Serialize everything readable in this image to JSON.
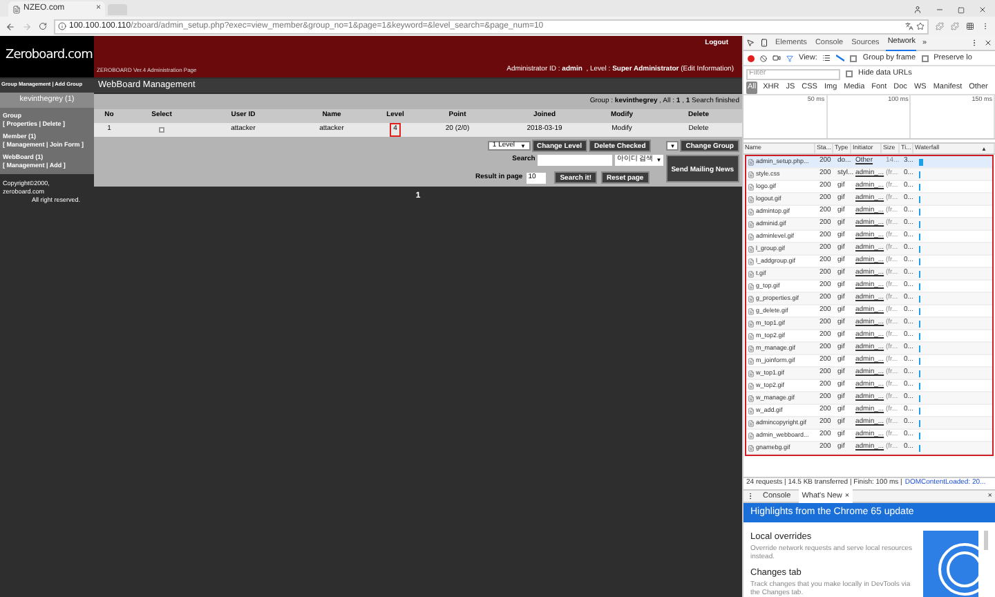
{
  "browser": {
    "tab_title": "NZEO.com",
    "tab_close": "×",
    "url_host": "100.100.100.110",
    "url_path": "/zboard/admin_setup.php?exec=view_member&group_no=1&page=1&keyword=&level_search=&page_num=10"
  },
  "header": {
    "logo": "Zeroboard.com",
    "subtitle": "ZEROBOARD Ver.4 Administration Page",
    "logout": "Logout",
    "admin_label": "Administrator ID :",
    "admin_id": "admin",
    "level_label": ", Level :",
    "level": "Super Administrator",
    "edit": "(Edit Information)"
  },
  "sidebar": {
    "top_links": "Group Management | Add Group",
    "group_name": "kevinthegrey (1)",
    "sections": [
      {
        "title": "Group",
        "links": "[ Properties | Delete ]"
      },
      {
        "title": "Member (1)",
        "links": "[ Management | Join Form ]"
      },
      {
        "title": "WebBoard (1)",
        "links": "[ Management | Add ]"
      }
    ],
    "copyright": "Copyright©2000, zeroboard.com",
    "rights": "All right reserved."
  },
  "main": {
    "title": "WebBoard Management",
    "info": "Group : **kevinthegrey** , All : **1** , **1** Search finished",
    "table": {
      "columns": [
        "No",
        "Select",
        "User ID",
        "Name",
        "Level",
        "Point",
        "Joined",
        "Modify",
        "Delete"
      ],
      "rows": [
        {
          "no": "1",
          "checked": false,
          "user_id": "attacker",
          "name": "attacker",
          "level": "4",
          "level_highlighted": true,
          "point": "20 (2/0)",
          "joined": "2018-03-19",
          "modify": "Modify",
          "delete": "Delete"
        }
      ]
    },
    "level_select": "1 Level",
    "change_level": "Change Level",
    "delete_checked": "Delete Checked",
    "group_select_arrow": "▼",
    "change_group": "Change Group",
    "search_label": "Search",
    "search_select": "아이디 검색",
    "send_mailing": "Send Mailing News",
    "result_label": "Result in page",
    "result_value": "10",
    "search_button": "Search it!",
    "reset_button": "Reset page",
    "pages": [
      {
        "label": "1",
        "selected": true
      }
    ]
  },
  "devtools": {
    "tabs": [
      {
        "label": "Elements",
        "selected": false
      },
      {
        "label": "Console",
        "selected": false
      },
      {
        "label": "Sources",
        "selected": false
      },
      {
        "label": "Network",
        "selected": true
      }
    ],
    "more": "»",
    "view_label": "View:",
    "group_by_frame": {
      "label": "Group by frame",
      "checked": false
    },
    "preserve_log": {
      "label": "Preserve lo",
      "checked": false
    },
    "filter_placeholder": "Filter",
    "hide_data_urls": {
      "label": "Hide data URLs",
      "checked": false
    },
    "types": [
      {
        "label": "All",
        "selected": true
      },
      {
        "label": "XHR",
        "selected": false
      },
      {
        "label": "JS",
        "selected": false
      },
      {
        "label": "CSS",
        "selected": false
      },
      {
        "label": "Img",
        "selected": false
      },
      {
        "label": "Media",
        "selected": false
      },
      {
        "label": "Font",
        "selected": false
      },
      {
        "label": "Doc",
        "selected": false
      },
      {
        "label": "WS",
        "selected": false
      },
      {
        "label": "Manifest",
        "selected": false
      },
      {
        "label": "Other",
        "selected": false
      }
    ],
    "overview_ticks": [
      "50 ms",
      "100 ms",
      "150 ms"
    ],
    "network_table": {
      "highlighted": true,
      "columns": [
        "Name",
        "Sta...",
        "Type",
        "Initiator",
        "Size",
        "Ti...",
        "Waterfall"
      ],
      "sort_arrow": "▲",
      "rows": [
        {
          "name": "admin_setup.php...",
          "status": "200",
          "type": "do...",
          "initiator": "Other",
          "size": "14...",
          "time": "3...",
          "selected": true
        },
        {
          "name": "style.css",
          "status": "200",
          "type": "styl...",
          "initiator": "admin_...",
          "size": "(fr...",
          "time": "0...",
          "selected": false
        },
        {
          "name": "logo.gif",
          "status": "200",
          "type": "gif",
          "initiator": "admin_...",
          "size": "(fr...",
          "time": "0...",
          "selected": false
        },
        {
          "name": "logout.gif",
          "status": "200",
          "type": "gif",
          "initiator": "admin_...",
          "size": "(fr...",
          "time": "0...",
          "selected": false
        },
        {
          "name": "admintop.gif",
          "status": "200",
          "type": "gif",
          "initiator": "admin_...",
          "size": "(fr...",
          "time": "0...",
          "selected": false
        },
        {
          "name": "adminid.gif",
          "status": "200",
          "type": "gif",
          "initiator": "admin_...",
          "size": "(fr...",
          "time": "0...",
          "selected": false
        },
        {
          "name": "adminlevel.gif",
          "status": "200",
          "type": "gif",
          "initiator": "admin_...",
          "size": "(fr...",
          "time": "0...",
          "selected": false
        },
        {
          "name": "l_group.gif",
          "status": "200",
          "type": "gif",
          "initiator": "admin_...",
          "size": "(fr...",
          "time": "0...",
          "selected": false
        },
        {
          "name": "l_addgroup.gif",
          "status": "200",
          "type": "gif",
          "initiator": "admin_...",
          "size": "(fr...",
          "time": "0...",
          "selected": false
        },
        {
          "name": "t.gif",
          "status": "200",
          "type": "gif",
          "initiator": "admin_...",
          "size": "(fr...",
          "time": "0...",
          "selected": false
        },
        {
          "name": "g_top.gif",
          "status": "200",
          "type": "gif",
          "initiator": "admin_...",
          "size": "(fr...",
          "time": "0...",
          "selected": false
        },
        {
          "name": "g_properties.gif",
          "status": "200",
          "type": "gif",
          "initiator": "admin_...",
          "size": "(fr...",
          "time": "0...",
          "selected": false
        },
        {
          "name": "g_delete.gif",
          "status": "200",
          "type": "gif",
          "initiator": "admin_...",
          "size": "(fr...",
          "time": "0...",
          "selected": false
        },
        {
          "name": "m_top1.gif",
          "status": "200",
          "type": "gif",
          "initiator": "admin_...",
          "size": "(fr...",
          "time": "0...",
          "selected": false
        },
        {
          "name": "m_top2.gif",
          "status": "200",
          "type": "gif",
          "initiator": "admin_...",
          "size": "(fr...",
          "time": "0...",
          "selected": false
        },
        {
          "name": "m_manage.gif",
          "status": "200",
          "type": "gif",
          "initiator": "admin_...",
          "size": "(fr...",
          "time": "0...",
          "selected": false
        },
        {
          "name": "m_joinform.gif",
          "status": "200",
          "type": "gif",
          "initiator": "admin_...",
          "size": "(fr...",
          "time": "0...",
          "selected": false
        },
        {
          "name": "w_top1.gif",
          "status": "200",
          "type": "gif",
          "initiator": "admin_...",
          "size": "(fr...",
          "time": "0...",
          "selected": false
        },
        {
          "name": "w_top2.gif",
          "status": "200",
          "type": "gif",
          "initiator": "admin_...",
          "size": "(fr...",
          "time": "0...",
          "selected": false
        },
        {
          "name": "w_manage.gif",
          "status": "200",
          "type": "gif",
          "initiator": "admin_...",
          "size": "(fr...",
          "time": "0...",
          "selected": false
        },
        {
          "name": "w_add.gif",
          "status": "200",
          "type": "gif",
          "initiator": "admin_...",
          "size": "(fr...",
          "time": "0...",
          "selected": false
        },
        {
          "name": "admincopyright.gif",
          "status": "200",
          "type": "gif",
          "initiator": "admin_...",
          "size": "(fr...",
          "time": "0...",
          "selected": false
        },
        {
          "name": "admin_webboard...",
          "status": "200",
          "type": "gif",
          "initiator": "admin_...",
          "size": "(fr...",
          "time": "0...",
          "selected": false
        },
        {
          "name": "gnamebg.gif",
          "status": "200",
          "type": "gif",
          "initiator": "admin_...",
          "size": "(fr...",
          "time": "0...",
          "selected": false
        }
      ]
    },
    "summary": "24 requests | 14.5 KB transferred | Finish: 100 ms |",
    "dom_loaded": "DOMContentLoaded: 20...",
    "drawer_tabs": [
      {
        "label": "Console",
        "selected": false,
        "closable": false
      },
      {
        "label": "What's New",
        "selected": true,
        "closable": true
      }
    ],
    "close_tab": "×",
    "close_drawer": "×",
    "whats_new": {
      "title": "Highlights from the Chrome 65 update",
      "items": [
        {
          "title": "Local overrides",
          "text": "Override network requests and serve local resources instead."
        },
        {
          "title": "Changes tab",
          "text": "Track changes that you make locally in DevTools via the Changes tab."
        }
      ]
    }
  }
}
